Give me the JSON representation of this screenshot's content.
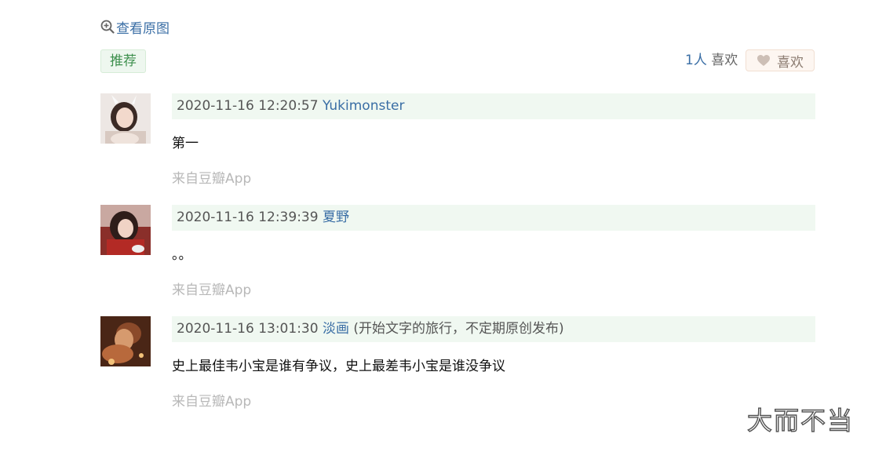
{
  "view_original": {
    "label": "查看原图",
    "icon": "zoom-in-icon"
  },
  "recommend_tag": {
    "label": "推荐"
  },
  "likes": {
    "count": "1人",
    "count_label": " 喜欢",
    "button_label": "喜欢",
    "icon": "heart-icon"
  },
  "comments": [
    {
      "timestamp": "2020-11-16 12:20:57",
      "author": "Yukimonster",
      "signature": "",
      "content": "第一",
      "source": "来自豆瓣App"
    },
    {
      "timestamp": "2020-11-16 12:39:39",
      "author": "夏野",
      "signature": "",
      "content": "。。",
      "source": "来自豆瓣App"
    },
    {
      "timestamp": "2020-11-16 13:01:30",
      "author": "淡画",
      "signature": "(开始文字的旅行，不定期原创发布)",
      "content": "史上最佳韦小宝是谁有争议，史上最差韦小宝是谁没争议",
      "source": "来自豆瓣App"
    }
  ],
  "watermark": "大而不当"
}
